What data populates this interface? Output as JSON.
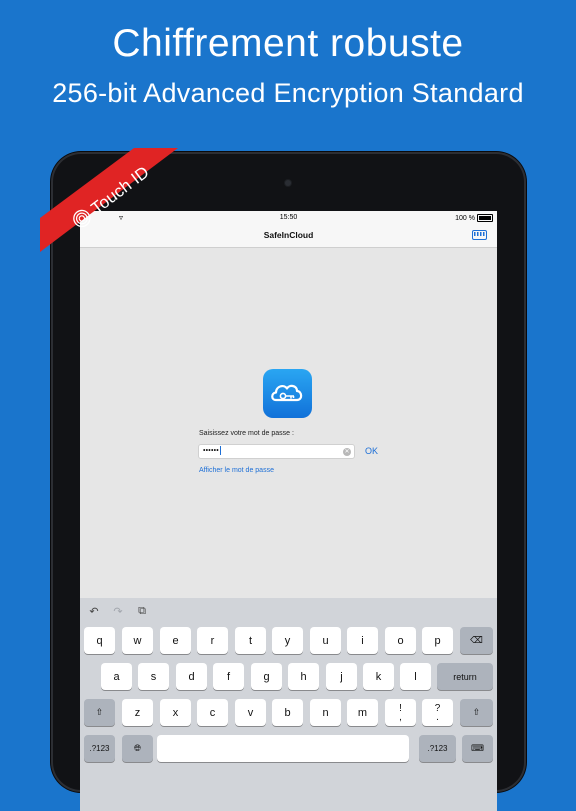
{
  "promo": {
    "headline": "Chiffrement robuste",
    "subheadline": "256-bit Advanced Encryption Standard",
    "ribbon_label": "Touch ID"
  },
  "status_bar": {
    "time": "15:50",
    "battery": "100 %"
  },
  "nav": {
    "title": "SafeInCloud"
  },
  "login": {
    "prompt": "Saisissez votre mot de passe :",
    "password_value": "••••••",
    "ok_label": "OK",
    "show_password": "Afficher le mot de passe"
  },
  "keyboard": {
    "row1": [
      "q",
      "w",
      "e",
      "r",
      "t",
      "y",
      "u",
      "i",
      "o",
      "p"
    ],
    "row2": [
      "a",
      "s",
      "d",
      "f",
      "g",
      "h",
      "j",
      "k",
      "l"
    ],
    "row3": [
      "z",
      "x",
      "c",
      "v",
      "b",
      "n",
      "m"
    ],
    "return_label": "return",
    "num_label": ".?123",
    "excl_top": "!",
    "excl_bottom": ",",
    "q_top": "?",
    "q_bottom": "."
  },
  "colors": {
    "background": "#1a75cc",
    "accent": "#1d6fd6",
    "ribbon": "#e02424"
  }
}
